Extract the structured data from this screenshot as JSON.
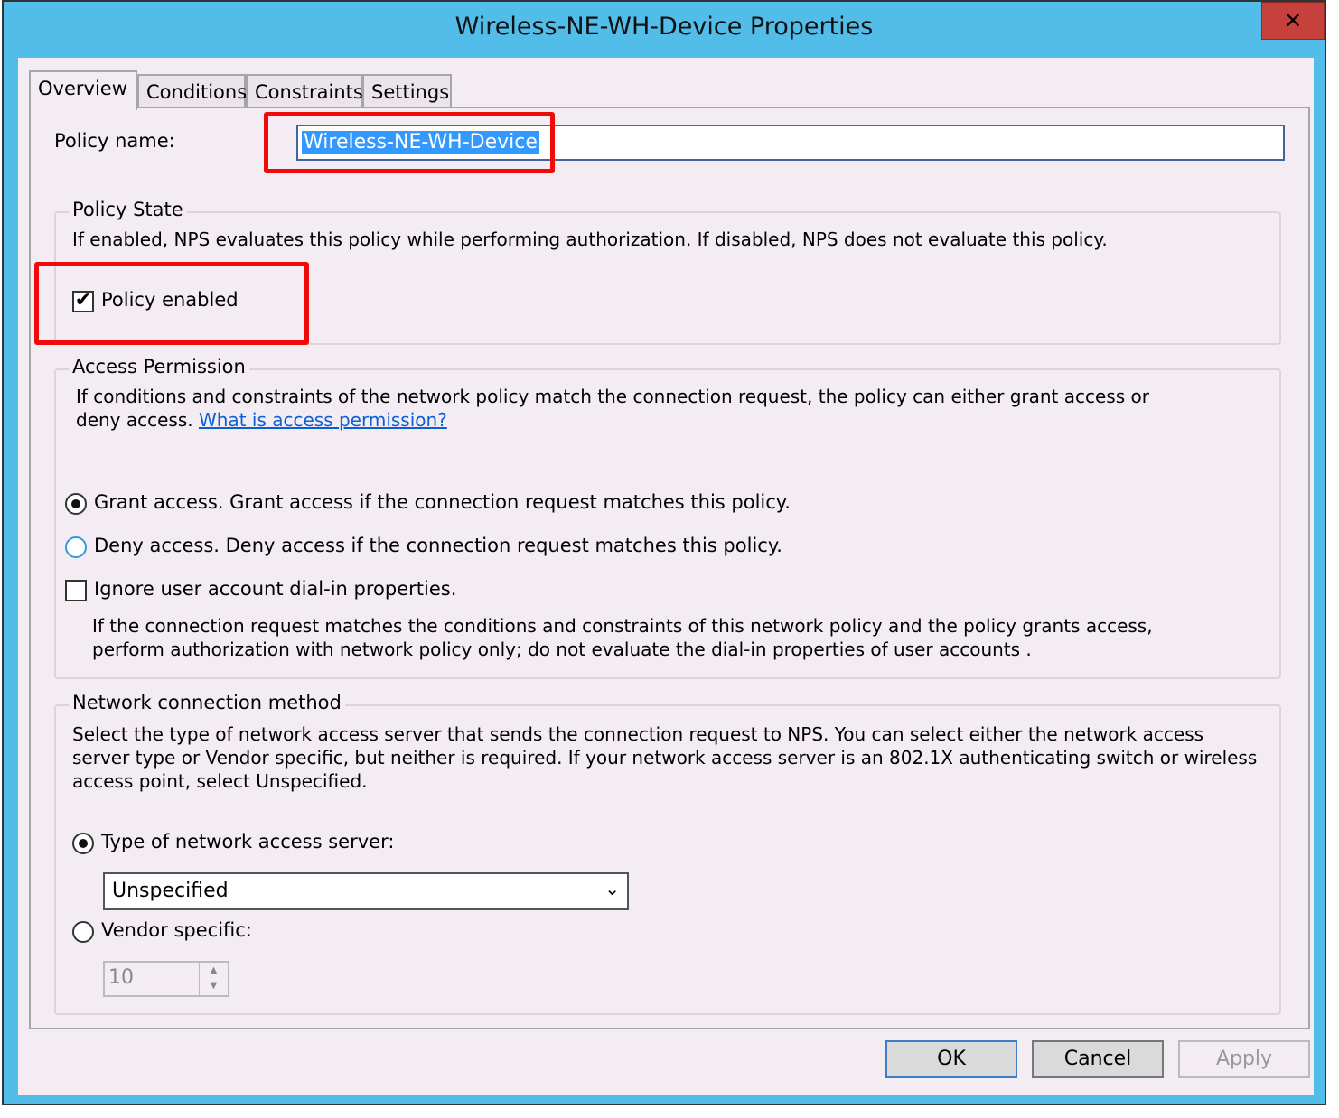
{
  "window": {
    "title": "Wireless-NE-WH-Device Properties",
    "close_glyph": "✕"
  },
  "tabs": [
    {
      "label": "Overview",
      "active": true
    },
    {
      "label": "Conditions"
    },
    {
      "label": "Constraints"
    },
    {
      "label": "Settings"
    }
  ],
  "policy_name": {
    "label": "Policy name:",
    "value": "Wireless-NE-WH-Device"
  },
  "policy_state": {
    "title": "Policy State",
    "description": "If enabled, NPS evaluates this policy while performing authorization. If disabled, NPS does not evaluate this policy.",
    "enabled_label": "Policy enabled",
    "enabled": true
  },
  "access_permission": {
    "title": "Access Permission",
    "description": "If conditions and constraints of the network policy match the connection request, the policy can either grant access or deny access.",
    "link": "What is access permission?",
    "grant_label": "Grant access. Grant access if the connection request matches this policy.",
    "deny_label": "Deny access. Deny access if the connection request matches this policy.",
    "selected": "grant",
    "ignore_label": "Ignore user account dial-in properties.",
    "ignore_checked": false,
    "ignore_description": "If the connection request matches the conditions and constraints of this network policy and the policy grants access, perform authorization with network policy only; do not evaluate the dial-in properties of user accounts ."
  },
  "network_method": {
    "title": "Network connection method",
    "description": "Select the type of network access server that sends the connection request to NPS. You can select either the network access server type or Vendor specific, but neither is required.  If your network access server is an 802.1X authenticating switch or wireless access point, select Unspecified.",
    "type_label": "Type of network access server:",
    "type_value": "Unspecified",
    "vendor_label": "Vendor specific:",
    "vendor_value": "10",
    "selected": "type"
  },
  "buttons": {
    "ok": "OK",
    "cancel": "Cancel",
    "apply": "Apply"
  },
  "colors": {
    "titlebar": "#53bde9",
    "highlight": "#f00a0a",
    "close": "#c7413c"
  }
}
